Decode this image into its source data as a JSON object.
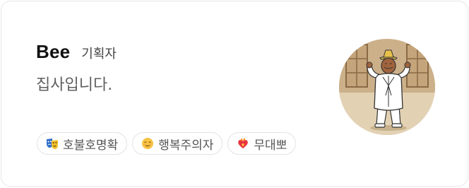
{
  "profile": {
    "name": "Bee",
    "role": "기획자",
    "bio": "집사입니다."
  },
  "tags": [
    {
      "label": "호불호명확",
      "icon": "performing-arts-masks-icon"
    },
    {
      "label": "행복주의자",
      "icon": "relieved-face-icon"
    },
    {
      "label": "무대뽀",
      "icon": "heart-on-fire-icon"
    }
  ],
  "colors": {
    "card_border": "#e6e6e6",
    "name_text": "#111111",
    "secondary_text": "#5f5f5f",
    "tag_border": "#e3e3e3",
    "avatar_background": "#d9c3a3"
  }
}
